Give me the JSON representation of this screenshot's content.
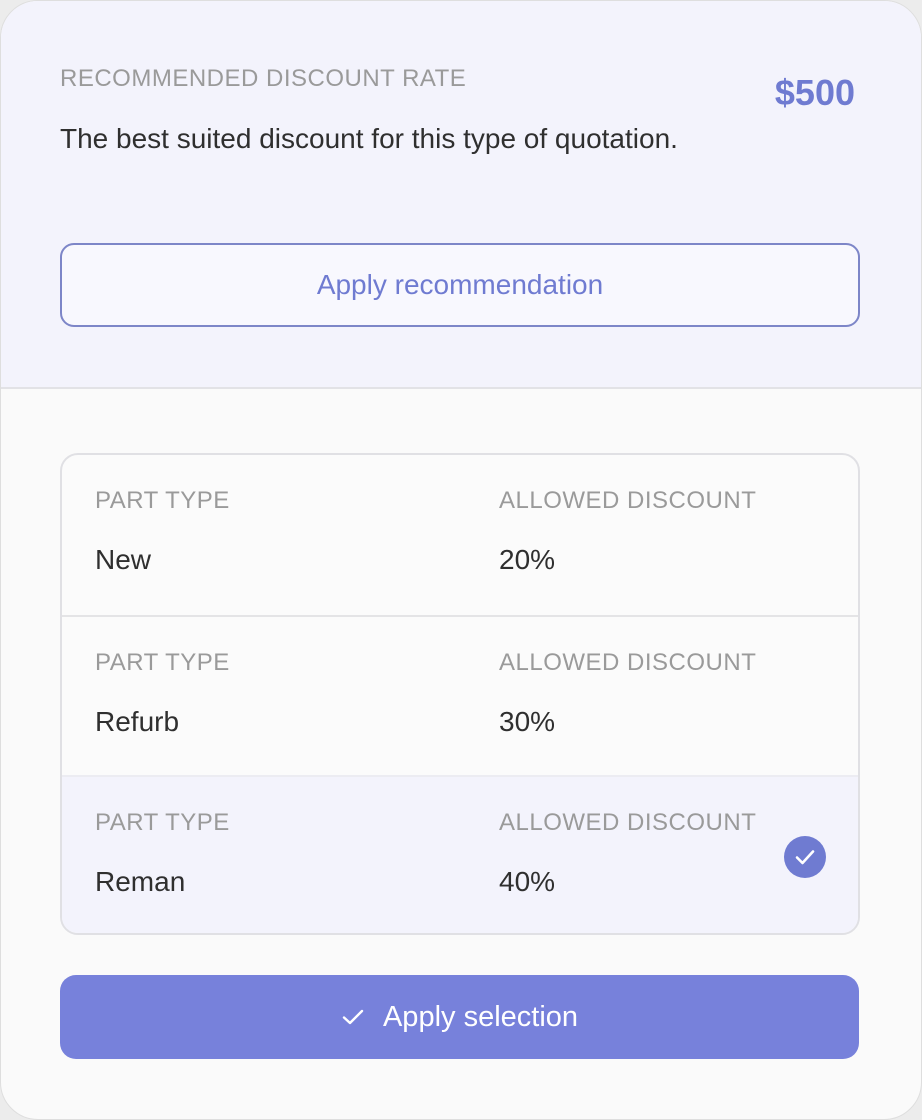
{
  "recommendation": {
    "label": "RECOMMENDED DISCOUNT RATE",
    "amount": "$500",
    "description": "The best suited discount for this type of quotation.",
    "apply_label": "Apply recommendation"
  },
  "options": {
    "rows": [
      {
        "part_type_header": "PART TYPE",
        "part_type": "New",
        "discount_header": "ALLOWED DISCOUNT",
        "discount": "20%",
        "selected": false
      },
      {
        "part_type_header": "PART TYPE",
        "part_type": "Refurb",
        "discount_header": "ALLOWED DISCOUNT",
        "discount": "30%",
        "selected": false
      },
      {
        "part_type_header": "PART TYPE",
        "part_type": "Reman",
        "discount_header": "ALLOWED DISCOUNT",
        "discount": "40%",
        "selected": true
      }
    ]
  },
  "footer": {
    "apply_label": "Apply selection",
    "apply_icon": "check-icon"
  },
  "colors": {
    "accent": "#6f7bd1",
    "button_fill": "#7781db",
    "highlight_bg": "#f3f3fc"
  }
}
